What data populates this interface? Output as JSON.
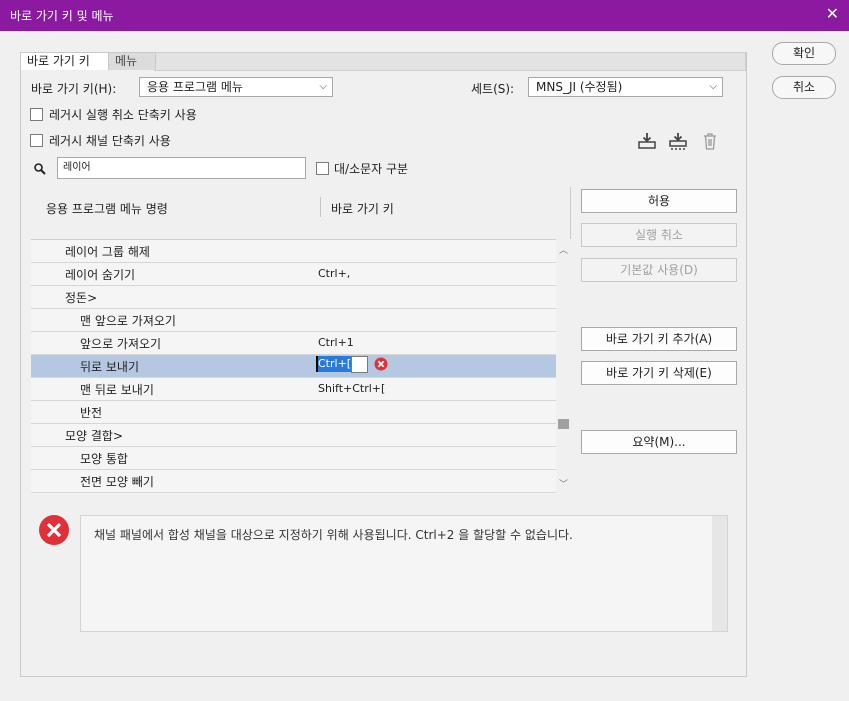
{
  "window": {
    "title": "바로 가기 키 및 메뉴"
  },
  "tabs": [
    {
      "label": "바로 가기 키"
    },
    {
      "label": "메뉴"
    }
  ],
  "shortcuts_for": {
    "label": "바로 가기 키(H):",
    "value": "응용 프로그램 메뉴"
  },
  "set": {
    "label": "세트(S):",
    "value": "MNS_JI (수정됨)"
  },
  "options": {
    "legacy_undo": "레거시 실행 취소 단축키 사용",
    "legacy_channel": "레거시 채널 단축키 사용",
    "case_sensitive": "대/소문자 구분"
  },
  "search": {
    "value": "레이어"
  },
  "columns": {
    "command": "응용 프로그램 메뉴 명령",
    "shortcut": "바로 가기 키"
  },
  "rows": [
    {
      "command": "레이어 그룹 해제",
      "shortcut": ""
    },
    {
      "command": "레이어 숨기기",
      "shortcut": "Ctrl+,"
    },
    {
      "command": "정돈>",
      "shortcut": ""
    },
    {
      "command": "맨 앞으로 가져오기",
      "shortcut": ""
    },
    {
      "command": "앞으로 가져오기",
      "shortcut": "Ctrl+1"
    },
    {
      "command": "뒤로 보내기",
      "shortcut": "Ctrl+["
    },
    {
      "command": "맨 뒤로 보내기",
      "shortcut": "Shift+Ctrl+["
    },
    {
      "command": "반전",
      "shortcut": ""
    },
    {
      "command": "모양 결합>",
      "shortcut": ""
    },
    {
      "command": "모양 통합",
      "shortcut": ""
    },
    {
      "command": "전면 모양 빼기",
      "shortcut": ""
    }
  ],
  "buttons": {
    "ok": "확인",
    "cancel": "취소",
    "accept": "허용",
    "undo": "실행 취소",
    "use_default": "기본값 사용(D)",
    "add_shortcut": "바로 가기 키 추가(A)",
    "delete_shortcut": "바로 가기 키 삭제(E)",
    "summarize": "요약(M)..."
  },
  "message": "채널 패널에서 합성 채널을 대상으로 지정하기 위해 사용됩니다. Ctrl+2 을 할당할 수 없습니다.",
  "icons": {
    "save_set": "save-set-icon",
    "save_set_as": "save-set-as-icon",
    "delete_set": "trash-icon",
    "search": "magnifier-icon",
    "error": "error-icon"
  },
  "colors": {
    "titlebar": "#8b1aa0",
    "selection": "#b5c8e2",
    "error": "#e0303a",
    "text_selection": "#2a7ad9"
  }
}
